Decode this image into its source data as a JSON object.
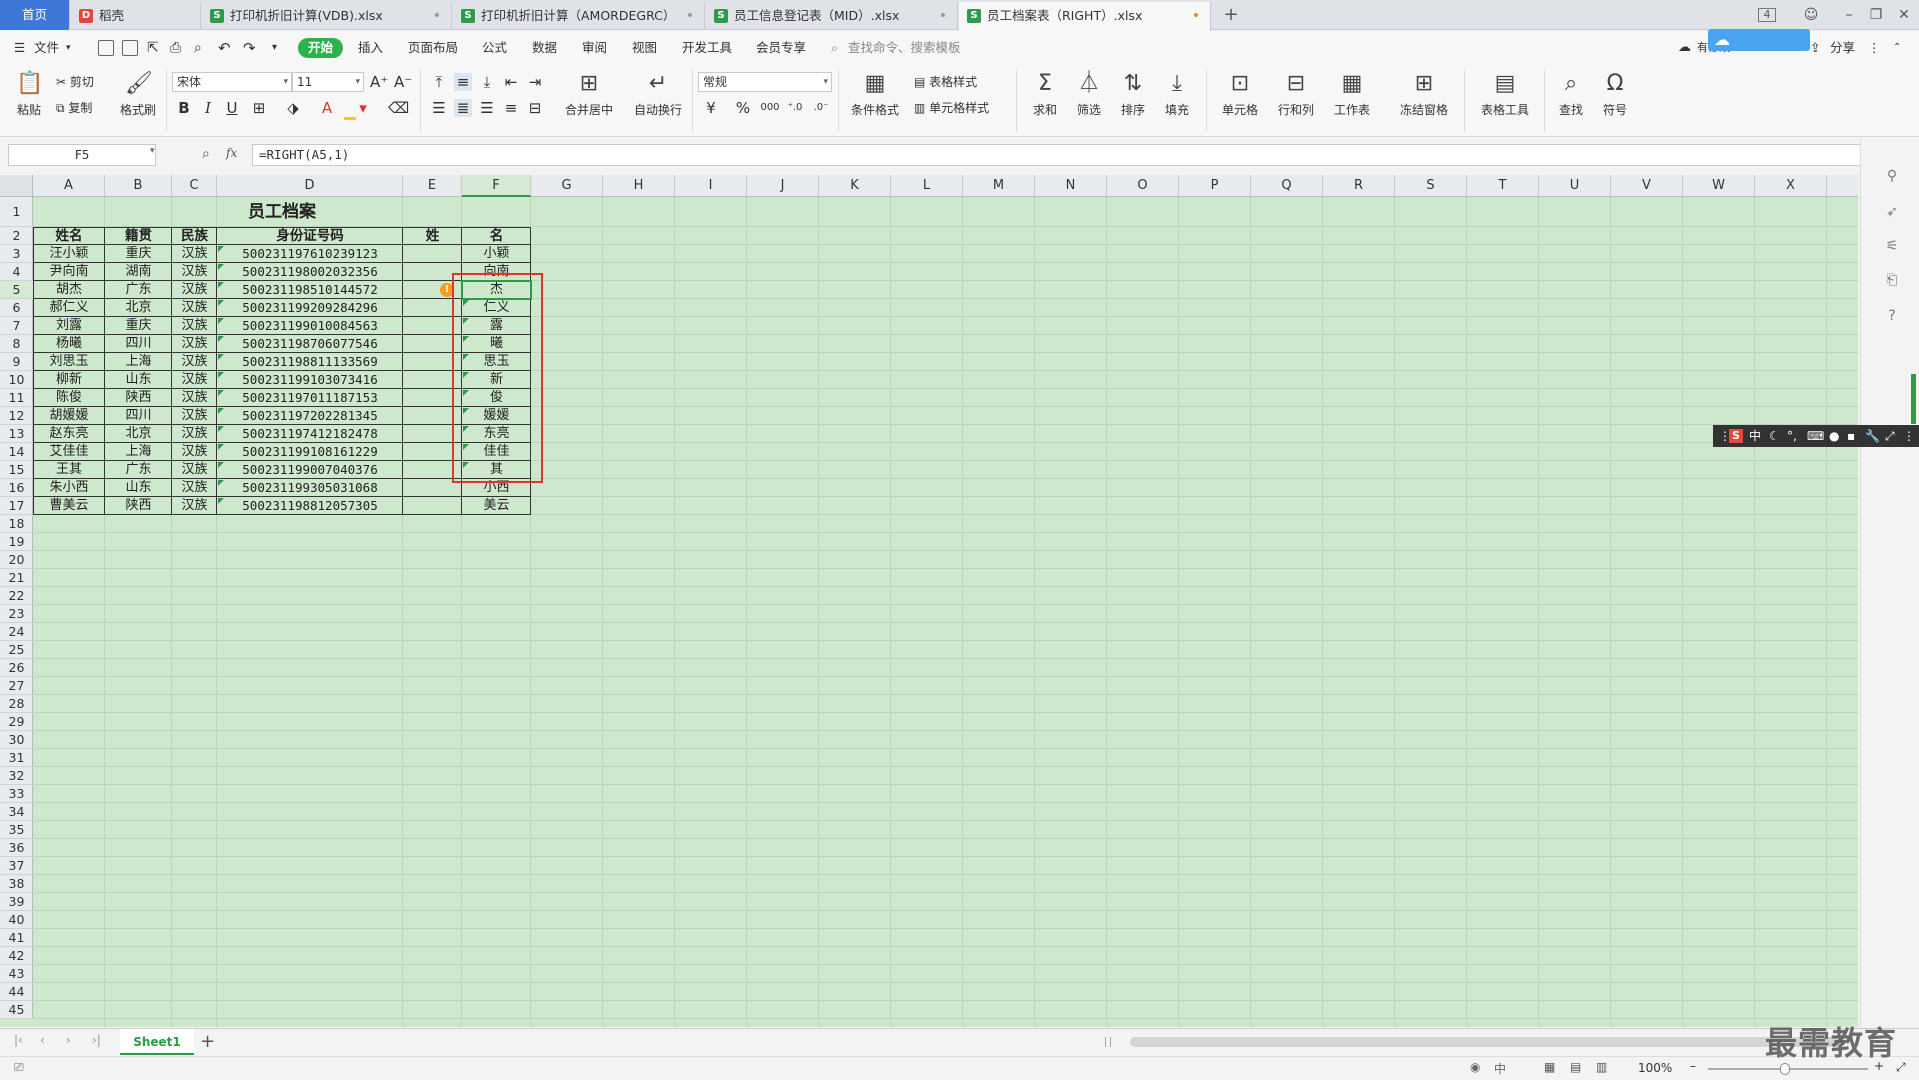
{
  "tabs": [
    {
      "label": "首页"
    },
    {
      "label": "稻壳",
      "icon": "D"
    },
    {
      "label": "打印机折旧计算(VDB).xlsx",
      "icon": "S"
    },
    {
      "label": "打印机折旧计算（AMORDEGRC）",
      "icon": "S"
    },
    {
      "label": "员工信息登记表（MID）.xlsx",
      "icon": "S"
    },
    {
      "label": "员工档案表（RIGHT）.xlsx",
      "icon": "S"
    }
  ],
  "tab_count_badge": "4",
  "menu": {
    "file": "文件",
    "start": "开始",
    "items": [
      "插入",
      "页面布局",
      "公式",
      "数据",
      "审阅",
      "视图",
      "开发工具",
      "会员专享"
    ],
    "search_placeholder": "查找命令、搜索模板",
    "share": "分享",
    "sync_badge": "有修改"
  },
  "ribbon": {
    "paste": "粘贴",
    "cut": "剪切",
    "copy": "复制",
    "format_painter": "格式刷",
    "font_name": "宋体",
    "font_size": "11",
    "merge_center": "合并居中",
    "auto_wrap": "自动换行",
    "number_format": "常规",
    "currency": "¥",
    "percent": "%",
    "thousands": "000",
    "cond_format": "条件格式",
    "table_style": "表格样式",
    "cell_style": "单元格样式",
    "sum": "求和",
    "filter": "筛选",
    "sort": "排序",
    "fill": "填充",
    "cell": "单元格",
    "row_col": "行和列",
    "worksheet": "工作表",
    "freeze": "冻结窗格",
    "table_tools": "表格工具",
    "find": "查找",
    "symbol": "符号"
  },
  "formula": {
    "name_box": "F5",
    "fx": "fx",
    "content": "=RIGHT(A5,1)"
  },
  "columns": [
    "A",
    "B",
    "C",
    "D",
    "E",
    "F",
    "G",
    "H",
    "I",
    "J",
    "K",
    "L",
    "M",
    "N",
    "O",
    "P",
    "Q",
    "R",
    "S",
    "T",
    "U",
    "V",
    "W",
    "X"
  ],
  "rows": [
    "1",
    "2",
    "3",
    "4",
    "5",
    "6",
    "7",
    "8",
    "9",
    "10",
    "11",
    "12",
    "13",
    "14",
    "15",
    "16",
    "17",
    "18",
    "19",
    "20",
    "21",
    "22",
    "23",
    "24",
    "25",
    "26",
    "27",
    "28",
    "29",
    "30",
    "31",
    "32",
    "33",
    "34",
    "35",
    "36",
    "37",
    "38",
    "39",
    "40",
    "41",
    "42",
    "43",
    "44",
    "45"
  ],
  "sheet": {
    "title": "员工档案",
    "headers": [
      "姓名",
      "籍贯",
      "民族",
      "身份证号码",
      "姓",
      "名"
    ],
    "data": [
      [
        "汪小颖",
        "重庆",
        "汉族",
        "500231197610239123",
        "",
        "小颖"
      ],
      [
        "尹向南",
        "湖南",
        "汉族",
        "500231198002032356",
        "",
        "向南"
      ],
      [
        "胡杰",
        "广东",
        "汉族",
        "500231198510144572",
        "",
        "杰"
      ],
      [
        "郝仁义",
        "北京",
        "汉族",
        "500231199209284296",
        "",
        "仁义"
      ],
      [
        "刘露",
        "重庆",
        "汉族",
        "500231199010084563",
        "",
        "露"
      ],
      [
        "杨曦",
        "四川",
        "汉族",
        "500231198706077546",
        "",
        "曦"
      ],
      [
        "刘思玉",
        "上海",
        "汉族",
        "500231198811133569",
        "",
        "思玉"
      ],
      [
        "柳新",
        "山东",
        "汉族",
        "500231199103073416",
        "",
        "新"
      ],
      [
        "陈俊",
        "陕西",
        "汉族",
        "500231197011187153",
        "",
        "俊"
      ],
      [
        "胡媛媛",
        "四川",
        "汉族",
        "500231197202281345",
        "",
        "媛媛"
      ],
      [
        "赵东亮",
        "北京",
        "汉族",
        "500231197412182478",
        "",
        "东亮"
      ],
      [
        "艾佳佳",
        "上海",
        "汉族",
        "500231199108161229",
        "",
        "佳佳"
      ],
      [
        "王其",
        "广东",
        "汉族",
        "500231199007040376",
        "",
        "其"
      ],
      [
        "朱小西",
        "山东",
        "汉族",
        "500231199305031068",
        "",
        "小西"
      ],
      [
        "曹美云",
        "陕西",
        "汉族",
        "500231198812057305",
        "",
        "美云"
      ]
    ]
  },
  "sheet_tab": "Sheet1",
  "status": {
    "zoom": "100%",
    "ime_lang": "中"
  },
  "ime": {
    "label": "中"
  },
  "watermark": "最需教育"
}
